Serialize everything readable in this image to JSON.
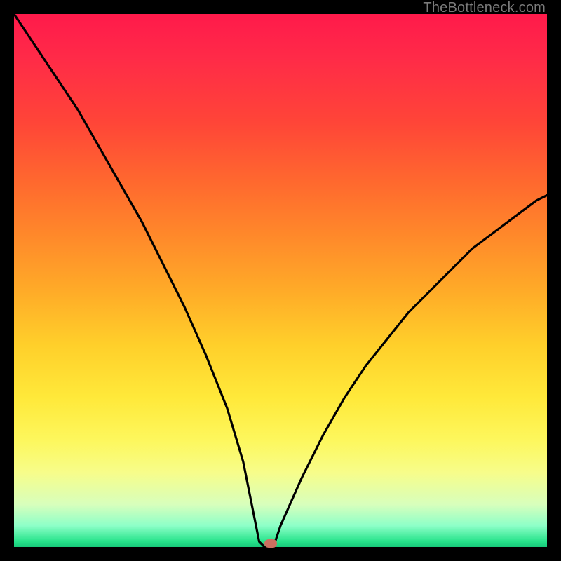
{
  "watermark": "TheBottleneck.com",
  "colors": {
    "frame": "#000000",
    "gradient_top": "#ff1a4b",
    "gradient_bottom": "#18c87a",
    "curve": "#000000",
    "marker": "#cc6f60",
    "watermark_text": "#7b7b7b"
  },
  "chart_data": {
    "type": "line",
    "title": "",
    "xlabel": "",
    "ylabel": "",
    "xlim": [
      0,
      100
    ],
    "ylim": [
      0,
      100
    ],
    "legend": false,
    "grid": false,
    "note": "Y is roughly bottleneck percentage; 0 = no bottleneck (green), 100 = full bottleneck (red). Visual V-curve with minimum near x≈47.",
    "x": [
      0,
      4,
      8,
      12,
      16,
      20,
      24,
      28,
      32,
      36,
      40,
      43,
      45,
      46,
      47,
      48,
      49,
      50,
      54,
      58,
      62,
      66,
      70,
      74,
      78,
      82,
      86,
      90,
      94,
      98,
      100
    ],
    "y": [
      100,
      94,
      88,
      82,
      75,
      68,
      61,
      53,
      45,
      36,
      26,
      16,
      6,
      1,
      0,
      0,
      1,
      4,
      13,
      21,
      28,
      34,
      39,
      44,
      48,
      52,
      56,
      59,
      62,
      65,
      66
    ],
    "marker": {
      "x": 48.2,
      "y": 0.6
    }
  }
}
